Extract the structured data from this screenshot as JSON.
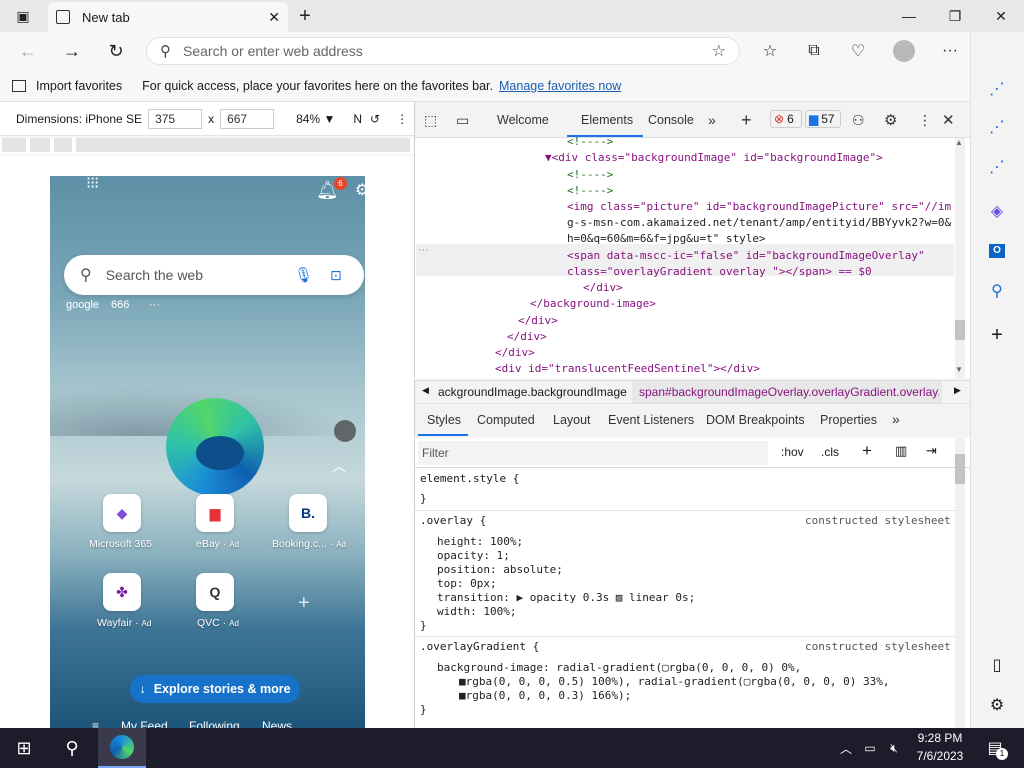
{
  "browser": {
    "tab_title": "New tab",
    "address_placeholder": "Search or enter web address",
    "favorites": {
      "import_label": "Import favorites",
      "hint": "For quick access, place your favorites here on the favorites bar.",
      "manage_link": "Manage favorites now"
    }
  },
  "emulation": {
    "dimensions_label": "Dimensions: iPhone SE",
    "width": "375",
    "height": "667",
    "times": "x",
    "zoom": "84%",
    "n_label": "N"
  },
  "phone": {
    "notification_count": "6",
    "search_placeholder": "Search the web",
    "quick_links": [
      "google",
      "666",
      "···"
    ],
    "tiles": [
      {
        "label": "Microsoft 365",
        "ad": "",
        "glyph": "◆",
        "color": "#7b4fd6"
      },
      {
        "label": "eBay",
        "ad": "Ad",
        "glyph": "▆",
        "color": "#e53238"
      },
      {
        "label": "Booking.c...",
        "ad": "Ad",
        "glyph": "B.",
        "color": "#003580"
      },
      {
        "label": "Wayfair",
        "ad": "Ad",
        "glyph": "✤",
        "color": "#7b189f"
      },
      {
        "label": "QVC",
        "ad": "Ad",
        "glyph": "Q",
        "color": "#333333"
      }
    ],
    "explore_label": "Explore stories & more",
    "feed_nav": [
      "My Feed",
      "Following",
      "News"
    ]
  },
  "devtools": {
    "tabs": [
      "Welcome",
      "Elements",
      "Console"
    ],
    "active_tab": "Elements",
    "errors": "6",
    "messages": "57",
    "elements_lines": [
      {
        "indent": 0,
        "text": "<!---->",
        "kind": "cm"
      },
      {
        "indent": 0,
        "text": "▼<div class=\"backgroundImage\" id=\"backgroundImage\">",
        "kind": "tg"
      },
      {
        "indent": 1,
        "text": "<!---->",
        "kind": "cm"
      },
      {
        "indent": 1,
        "text": "<!---->",
        "kind": "cm"
      },
      {
        "indent": 1,
        "text": "<img class=\"picture\" id=\"backgroundImagePicture\" src=\"//im",
        "kind": "tg"
      },
      {
        "indent": 1,
        "text": "g-s-msn-com.akamaized.net/tenant/amp/entityid/BBYyvk2?w=0&",
        "kind": "tx"
      },
      {
        "indent": 1,
        "text": "h=0&q=60&m=6&f=jpg&u=t\" style>",
        "kind": "tx"
      },
      {
        "indent": 1,
        "text": "<span data-mscc-ic=\"false\" id=\"backgroundImageOverlay\"",
        "kind": "tg"
      },
      {
        "indent": 1,
        "text": "class=\"overlayGradient overlay \"></span> == $0",
        "kind": "tg"
      },
      {
        "indent": 0,
        "text": "</div>",
        "kind": "tg"
      },
      {
        "indent": -1,
        "text": "</background-image>",
        "kind": "tg"
      },
      {
        "indent": -2,
        "text": "</div>",
        "kind": "tg"
      },
      {
        "indent": -3,
        "text": "</div>",
        "kind": "tg"
      },
      {
        "indent": -4,
        "text": "</div>",
        "kind": "tg"
      },
      {
        "indent": -4,
        "text": "<div id=\"translucentFeedSentinel\"></div>",
        "kind": "tg"
      }
    ],
    "breadcrumbs": [
      "ackgroundImage.backgroundImage",
      "span#backgroundImageOverlay.overlayGradient.overlay."
    ],
    "subtabs": [
      "Styles",
      "Computed",
      "Layout",
      "Event Listeners",
      "DOM Breakpoints",
      "Properties"
    ],
    "active_subtab": "Styles",
    "filter_placeholder": "Filter",
    "hov": ":hov",
    "cls": ".cls",
    "styles": {
      "element_style_open": "element.style {",
      "element_style_close": "}",
      "overlay_selector": ".overlay {",
      "overlay_source": "constructed stylesheet",
      "overlay_props": [
        "height: 100%;",
        "opacity: 1;",
        "position: absolute;",
        "top: 0px;",
        "transition: ▶ opacity 0.3s ▨ linear 0s;",
        "width: 100%;"
      ],
      "overlay_close": "}",
      "gradient_selector": ".overlayGradient {",
      "gradient_source": "constructed stylesheet",
      "gradient_lines": [
        "background-image: radial-gradient(▢rgba(0, 0, 0, 0) 0%,",
        "■rgba(0, 0, 0, 0.5) 100%), radial-gradient(▢rgba(0, 0, 0, 0) 33%,",
        "■rgba(0, 0, 0, 0.3) 166%);"
      ],
      "gradient_close": "}"
    }
  },
  "taskbar": {
    "time": "9:28 PM",
    "date": "7/6/2023",
    "notif_count": "1"
  }
}
